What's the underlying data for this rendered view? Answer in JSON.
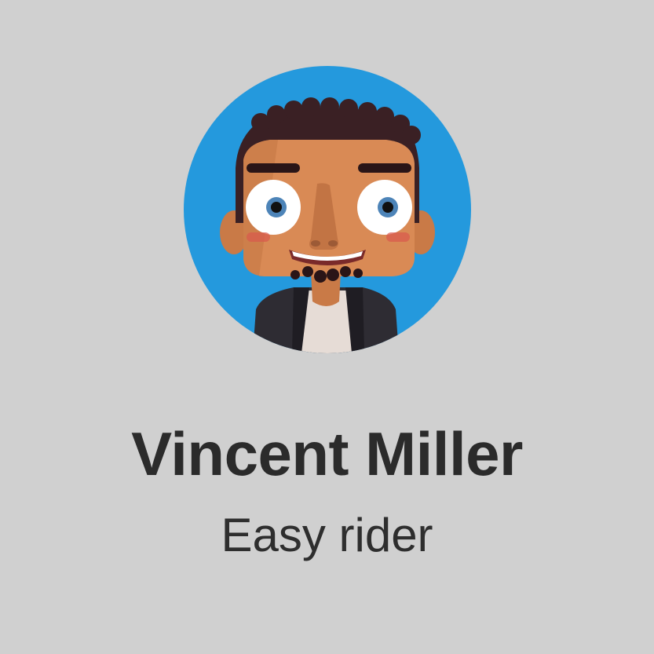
{
  "profile": {
    "name": "Vincent Miller",
    "tagline": "Easy rider",
    "avatar": {
      "icon": "cartoon-man-avatar-icon",
      "background_color": "#2499dd"
    }
  },
  "colors": {
    "page_background": "#d0d0d0",
    "text_primary": "#2b2b2b",
    "skin": "#d98a55",
    "hair": "#3a2024",
    "jacket": "#2e2c33",
    "shirt": "#e6dcd6"
  }
}
